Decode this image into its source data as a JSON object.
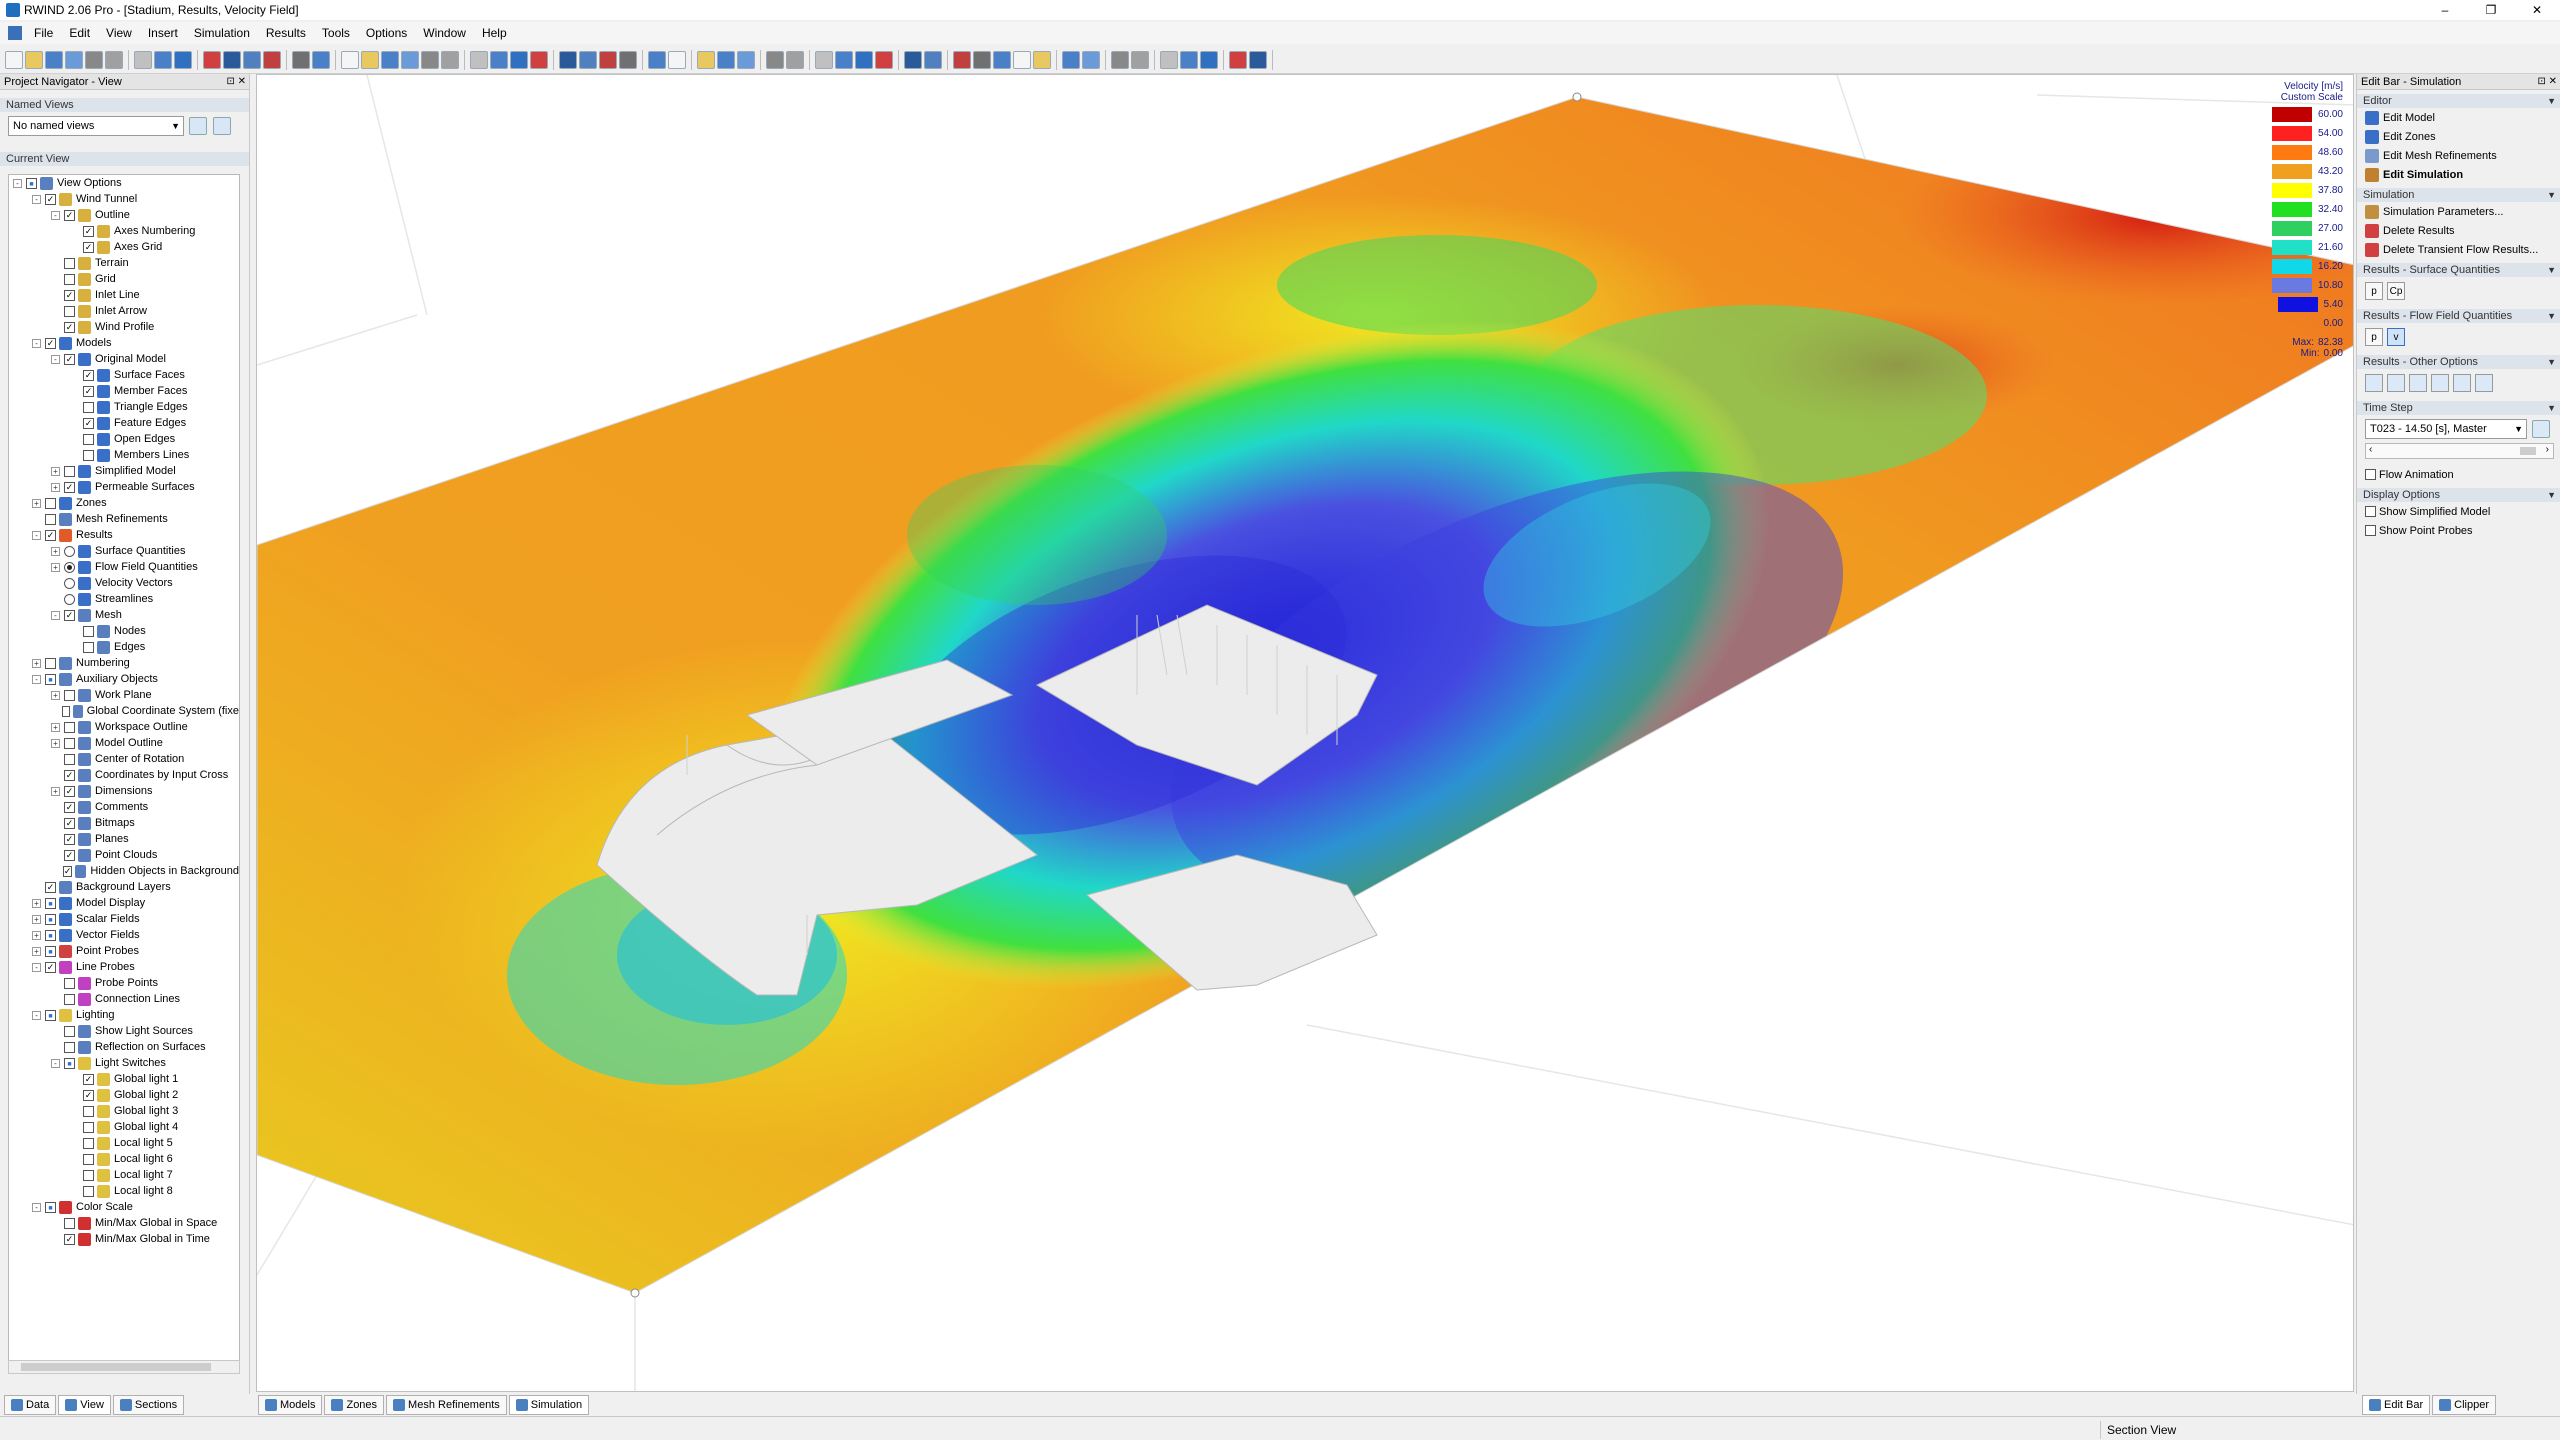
{
  "window": {
    "title": "RWIND 2.06 Pro - [Stadium, Results, Velocity Field]",
    "min": "–",
    "max": "❐",
    "close": "✕"
  },
  "menu": [
    "File",
    "Edit",
    "View",
    "Insert",
    "Simulation",
    "Results",
    "Tools",
    "Options",
    "Window",
    "Help"
  ],
  "nav": {
    "title": "Project Navigator - View",
    "named_views_label": "Named Views",
    "named_views_value": "No named views",
    "current_view_label": "Current View",
    "tree": [
      {
        "d": 0,
        "e": "-",
        "c": "part",
        "t": "View Options",
        "i": "#5a7fbf"
      },
      {
        "d": 1,
        "e": "-",
        "c": "on",
        "t": "Wind Tunnel",
        "i": "#d8b040"
      },
      {
        "d": 2,
        "e": "-",
        "c": "on",
        "t": "Outline",
        "i": "#d8b040"
      },
      {
        "d": 3,
        "e": "",
        "c": "on",
        "t": "Axes Numbering",
        "i": "#d8b040"
      },
      {
        "d": 3,
        "e": "",
        "c": "on",
        "t": "Axes Grid",
        "i": "#d8b040"
      },
      {
        "d": 2,
        "e": "",
        "c": "off",
        "t": "Terrain",
        "i": "#d8b040"
      },
      {
        "d": 2,
        "e": "",
        "c": "off",
        "t": "Grid",
        "i": "#d8b040"
      },
      {
        "d": 2,
        "e": "",
        "c": "on",
        "t": "Inlet Line",
        "i": "#d8b040"
      },
      {
        "d": 2,
        "e": "",
        "c": "off",
        "t": "Inlet Arrow",
        "i": "#d8b040"
      },
      {
        "d": 2,
        "e": "",
        "c": "on",
        "t": "Wind Profile",
        "i": "#d8b040"
      },
      {
        "d": 1,
        "e": "-",
        "c": "on",
        "t": "Models",
        "i": "#3a6fc8"
      },
      {
        "d": 2,
        "e": "-",
        "c": "on",
        "t": "Original Model",
        "i": "#3a6fc8"
      },
      {
        "d": 3,
        "e": "",
        "c": "on",
        "t": "Surface Faces",
        "i": "#3a6fc8"
      },
      {
        "d": 3,
        "e": "",
        "c": "on",
        "t": "Member Faces",
        "i": "#3a6fc8"
      },
      {
        "d": 3,
        "e": "",
        "c": "off",
        "t": "Triangle Edges",
        "i": "#3a6fc8"
      },
      {
        "d": 3,
        "e": "",
        "c": "on",
        "t": "Feature Edges",
        "i": "#3a6fc8"
      },
      {
        "d": 3,
        "e": "",
        "c": "off",
        "t": "Open Edges",
        "i": "#3a6fc8"
      },
      {
        "d": 3,
        "e": "",
        "c": "off",
        "t": "Members Lines",
        "i": "#3a6fc8"
      },
      {
        "d": 2,
        "e": "+",
        "c": "off",
        "t": "Simplified Model",
        "i": "#3a6fc8"
      },
      {
        "d": 2,
        "e": "+",
        "c": "on",
        "t": "Permeable Surfaces",
        "i": "#3a6fc8"
      },
      {
        "d": 1,
        "e": "+",
        "c": "off",
        "t": "Zones",
        "i": "#3a6fc8"
      },
      {
        "d": 1,
        "e": "",
        "c": "off",
        "t": "Mesh Refinements",
        "i": "#5a7fbf"
      },
      {
        "d": 1,
        "e": "-",
        "c": "on",
        "t": "Results",
        "i": "#e05a2a"
      },
      {
        "d": 2,
        "e": "+",
        "r": "off",
        "t": "Surface Quantities",
        "i": "#3a6fc8"
      },
      {
        "d": 2,
        "e": "+",
        "r": "on",
        "t": "Flow Field Quantities",
        "i": "#3a6fc8"
      },
      {
        "d": 2,
        "e": "",
        "r": "off",
        "t": "Velocity Vectors",
        "i": "#3a6fc8"
      },
      {
        "d": 2,
        "e": "",
        "r": "off",
        "t": "Streamlines",
        "i": "#3a6fc8"
      },
      {
        "d": 2,
        "e": "-",
        "c": "on",
        "t": "Mesh",
        "i": "#5a7fbf"
      },
      {
        "d": 3,
        "e": "",
        "c": "off",
        "t": "Nodes",
        "i": "#5a7fbf"
      },
      {
        "d": 3,
        "e": "",
        "c": "off",
        "t": "Edges",
        "i": "#5a7fbf"
      },
      {
        "d": 1,
        "e": "+",
        "c": "off",
        "t": "Numbering",
        "i": "#5a7fbf"
      },
      {
        "d": 1,
        "e": "-",
        "c": "part",
        "t": "Auxiliary Objects",
        "i": "#5a7fbf"
      },
      {
        "d": 2,
        "e": "+",
        "c": "off",
        "t": "Work Plane",
        "i": "#5a7fbf"
      },
      {
        "d": 2,
        "e": "",
        "c": "off",
        "t": "Global Coordinate System (fixe",
        "i": "#5a7fbf"
      },
      {
        "d": 2,
        "e": "+",
        "c": "off",
        "t": "Workspace Outline",
        "i": "#5a7fbf"
      },
      {
        "d": 2,
        "e": "+",
        "c": "off",
        "t": "Model Outline",
        "i": "#5a7fbf"
      },
      {
        "d": 2,
        "e": "",
        "c": "off",
        "t": "Center of Rotation",
        "i": "#5a7fbf"
      },
      {
        "d": 2,
        "e": "",
        "c": "on",
        "t": "Coordinates by Input Cross",
        "i": "#5a7fbf"
      },
      {
        "d": 2,
        "e": "+",
        "c": "on",
        "t": "Dimensions",
        "i": "#5a7fbf"
      },
      {
        "d": 2,
        "e": "",
        "c": "on",
        "t": "Comments",
        "i": "#5a7fbf"
      },
      {
        "d": 2,
        "e": "",
        "c": "on",
        "t": "Bitmaps",
        "i": "#5a7fbf"
      },
      {
        "d": 2,
        "e": "",
        "c": "on",
        "t": "Planes",
        "i": "#5a7fbf"
      },
      {
        "d": 2,
        "e": "",
        "c": "on",
        "t": "Point Clouds",
        "i": "#5a7fbf"
      },
      {
        "d": 2,
        "e": "",
        "c": "on",
        "t": "Hidden Objects in Background",
        "i": "#5a7fbf"
      },
      {
        "d": 1,
        "e": "",
        "c": "on",
        "t": "Background Layers",
        "i": "#5a7fbf"
      },
      {
        "d": 1,
        "e": "+",
        "c": "part",
        "t": "Model Display",
        "i": "#3a6fc8"
      },
      {
        "d": 1,
        "e": "+",
        "c": "part",
        "t": "Scalar Fields",
        "i": "#3a6fc8"
      },
      {
        "d": 1,
        "e": "+",
        "c": "part",
        "t": "Vector Fields",
        "i": "#3a6fc8"
      },
      {
        "d": 1,
        "e": "+",
        "c": "part",
        "t": "Point Probes",
        "i": "#d04040"
      },
      {
        "d": 1,
        "e": "-",
        "c": "on",
        "t": "Line Probes",
        "i": "#c040c0"
      },
      {
        "d": 2,
        "e": "",
        "c": "off",
        "t": "Probe Points",
        "i": "#c040c0"
      },
      {
        "d": 2,
        "e": "",
        "c": "off",
        "t": "Connection Lines",
        "i": "#c040c0"
      },
      {
        "d": 1,
        "e": "-",
        "c": "part",
        "t": "Lighting",
        "i": "#e0c040"
      },
      {
        "d": 2,
        "e": "",
        "c": "off",
        "t": "Show Light Sources",
        "i": "#5a7fbf"
      },
      {
        "d": 2,
        "e": "",
        "c": "off",
        "t": "Reflection on Surfaces",
        "i": "#5a7fbf"
      },
      {
        "d": 2,
        "e": "-",
        "c": "part",
        "t": "Light Switches",
        "i": "#e0c040"
      },
      {
        "d": 3,
        "e": "",
        "c": "on",
        "t": "Global light 1",
        "i": "#e0c040"
      },
      {
        "d": 3,
        "e": "",
        "c": "on",
        "t": "Global light 2",
        "i": "#e0c040"
      },
      {
        "d": 3,
        "e": "",
        "c": "off",
        "t": "Global light 3",
        "i": "#e0c040"
      },
      {
        "d": 3,
        "e": "",
        "c": "off",
        "t": "Global light 4",
        "i": "#e0c040"
      },
      {
        "d": 3,
        "e": "",
        "c": "off",
        "t": "Local light 5",
        "i": "#e0c040"
      },
      {
        "d": 3,
        "e": "",
        "c": "off",
        "t": "Local light 6",
        "i": "#e0c040"
      },
      {
        "d": 3,
        "e": "",
        "c": "off",
        "t": "Local light 7",
        "i": "#e0c040"
      },
      {
        "d": 3,
        "e": "",
        "c": "off",
        "t": "Local light 8",
        "i": "#e0c040"
      },
      {
        "d": 1,
        "e": "-",
        "c": "part",
        "t": "Color Scale",
        "i": "#d03030"
      },
      {
        "d": 2,
        "e": "",
        "c": "off",
        "t": "Min/Max Global in Space",
        "i": "#d03030"
      },
      {
        "d": 2,
        "e": "",
        "c": "on",
        "t": "Min/Max Global in Time",
        "i": "#d03030"
      }
    ],
    "tabs": [
      "Data",
      "View",
      "Sections"
    ]
  },
  "legend": {
    "title": "Velocity [m/s]",
    "subtitle": "Custom Scale",
    "entries": [
      {
        "v": "60.00",
        "c": "#c00000"
      },
      {
        "v": "54.00",
        "c": "#ff2020"
      },
      {
        "v": "48.60",
        "c": "#ff7a10"
      },
      {
        "v": "43.20",
        "c": "#f0a020"
      },
      {
        "v": "37.80",
        "c": "#ffff00"
      },
      {
        "v": "32.40",
        "c": "#20e020"
      },
      {
        "v": "27.00",
        "c": "#30d060"
      },
      {
        "v": "21.60",
        "c": "#20e0c8"
      },
      {
        "v": "16.20",
        "c": "#10d8e8"
      },
      {
        "v": "10.80",
        "c": "#6a7ae0"
      },
      {
        "v": "5.40",
        "c": "#1010e0"
      },
      {
        "v": "0.00",
        "c": ""
      }
    ],
    "max_label": "Max:",
    "max_value": "82.38",
    "min_label": "Min:",
    "min_value": "0.00"
  },
  "viewport_tabs": [
    "Models",
    "Zones",
    "Mesh Refinements",
    "Simulation"
  ],
  "editbar": {
    "title": "Edit Bar - Simulation",
    "editor_label": "Editor",
    "editor_items": [
      "Edit Model",
      "Edit Zones",
      "Edit Mesh Refinements",
      "Edit Simulation"
    ],
    "simulation_label": "Simulation",
    "simulation_items": [
      "Simulation Parameters...",
      "Delete Results",
      "Delete Transient Flow Results..."
    ],
    "surface_q_label": "Results - Surface Quantities",
    "surface_q_buttons": [
      "p",
      "Cp"
    ],
    "flow_q_label": "Results - Flow Field Quantities",
    "flow_q_buttons": [
      "p",
      "v"
    ],
    "other_label": "Results - Other Options",
    "time_step_label": "Time Step",
    "time_step_value": "T023 - 14.50 [s], Master",
    "flow_animation": "Flow Animation",
    "display_label": "Display Options",
    "display_items": [
      "Show Simplified Model",
      "Show Point Probes"
    ],
    "tabs": [
      "Edit Bar",
      "Clipper"
    ]
  },
  "status": {
    "section_view": "Section View"
  }
}
